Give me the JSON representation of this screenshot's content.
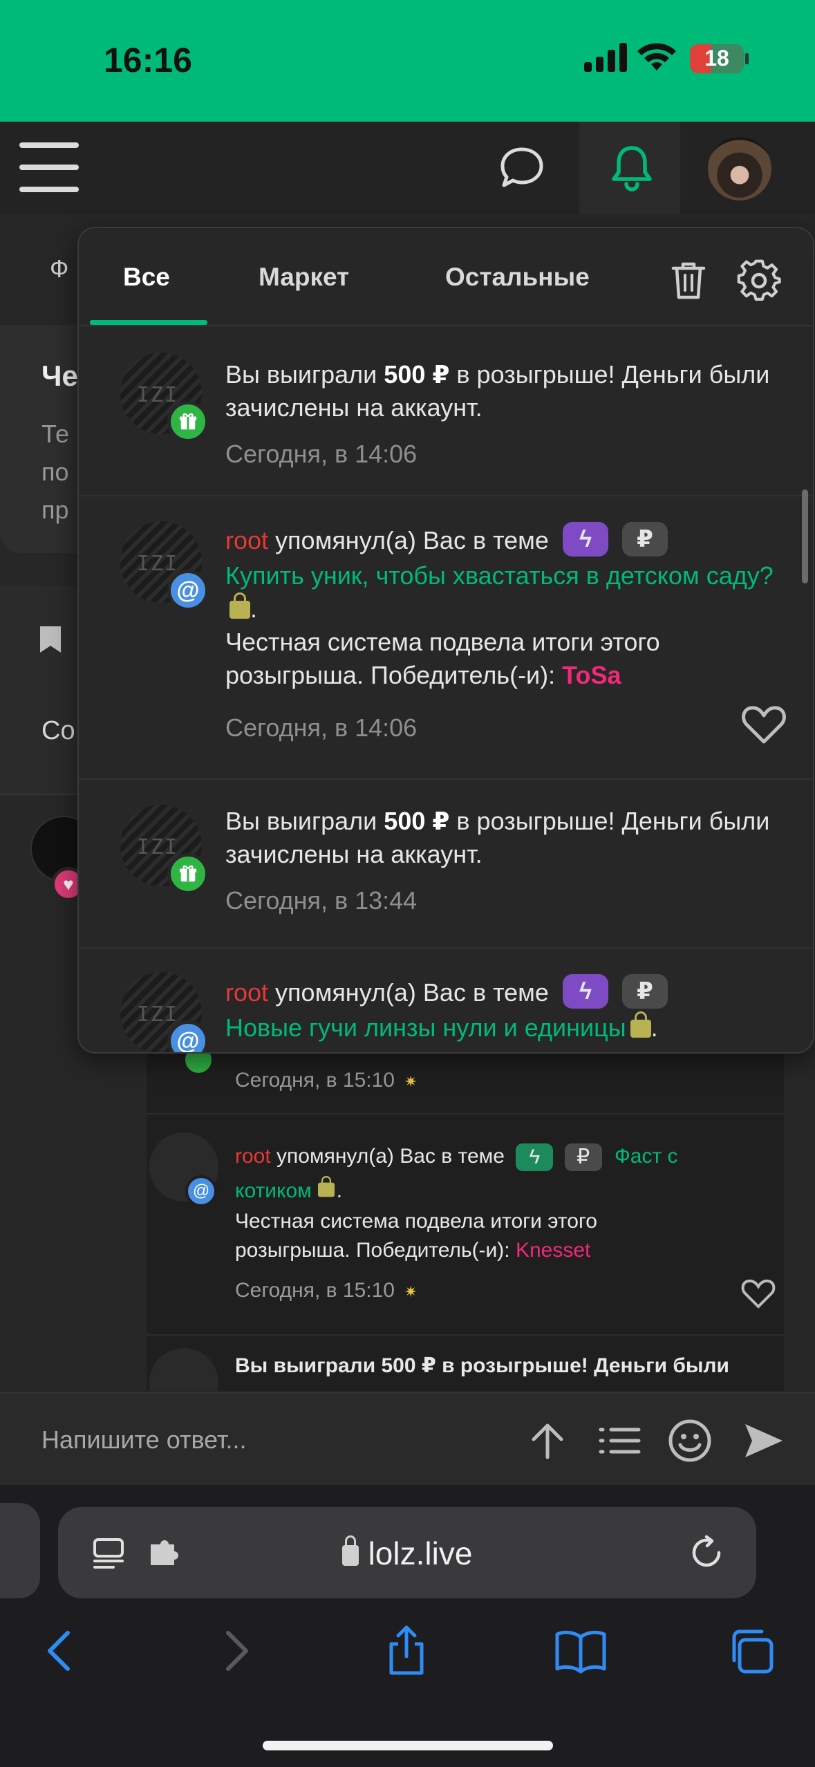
{
  "status_bar": {
    "time": "16:16",
    "battery": "18"
  },
  "header": {
    "menu_icon": "hamburger-icon",
    "chat_icon": "chat-bubble-icon",
    "bell_icon": "bell-icon",
    "accent_color": "#00ba78"
  },
  "background_page": {
    "tab_fragment": "Ф",
    "card_title_fragment": "Че",
    "card_text_fragments": [
      "Те",
      "по",
      "пр"
    ],
    "row_fragment": "Со"
  },
  "notifications_popup": {
    "tabs": [
      {
        "label": "Все",
        "active": true
      },
      {
        "label": "Маркет",
        "active": false
      },
      {
        "label": "Остальные",
        "active": false
      }
    ],
    "items": [
      {
        "type": "prize",
        "text_before": "Вы выиграли ",
        "amount": "500 ₽",
        "text_after": " в розыгрыше! Деньги были зачислены на аккаунт.",
        "time": "Сегодня, в 14:06"
      },
      {
        "type": "mention",
        "user": "root",
        "action": " упомянул(а) Вас в теме",
        "badge1": "ϟ",
        "badge2": "₽",
        "thread": "Купить уник, чтобы хвастаться в детском саду?",
        "body": "Честная система подвела итоги этого розыгрыша. Победитель(-и): ",
        "winner": "ToSa",
        "time": "Сегодня, в 14:06"
      },
      {
        "type": "prize",
        "text_before": "Вы выиграли ",
        "amount": "500 ₽",
        "text_after": " в розыгрыше! Деньги были зачислены на аккаунт.",
        "time": "Сегодня, в 13:44"
      },
      {
        "type": "mention",
        "user": "root",
        "action": " упомянул(а) Вас в теме",
        "badge1": "ϟ",
        "badge2": "₽",
        "thread": "Новые гучи линзы нули и единицы"
      }
    ]
  },
  "embedded_image": {
    "time1": "Сегодня, в 15:10",
    "mention": {
      "user": "root",
      "action": " упомянул(а) Вас в теме",
      "badge1": "ϟ",
      "badge2": "₽",
      "thread_part1": "Фаст с",
      "thread_part2": "котиком",
      "body_line1": "Честная система подвела итоги этого",
      "body_line2": "розыгрыша. Победитель(-и): ",
      "winner": "Knesset",
      "time": "Сегодня, в 15:10"
    },
    "prize_line": "Вы выиграли 500 ₽ в розыгрыше! Деньги были"
  },
  "reply_bar": {
    "placeholder": "Напишите ответ..."
  },
  "safari": {
    "url": "lolz.live"
  }
}
